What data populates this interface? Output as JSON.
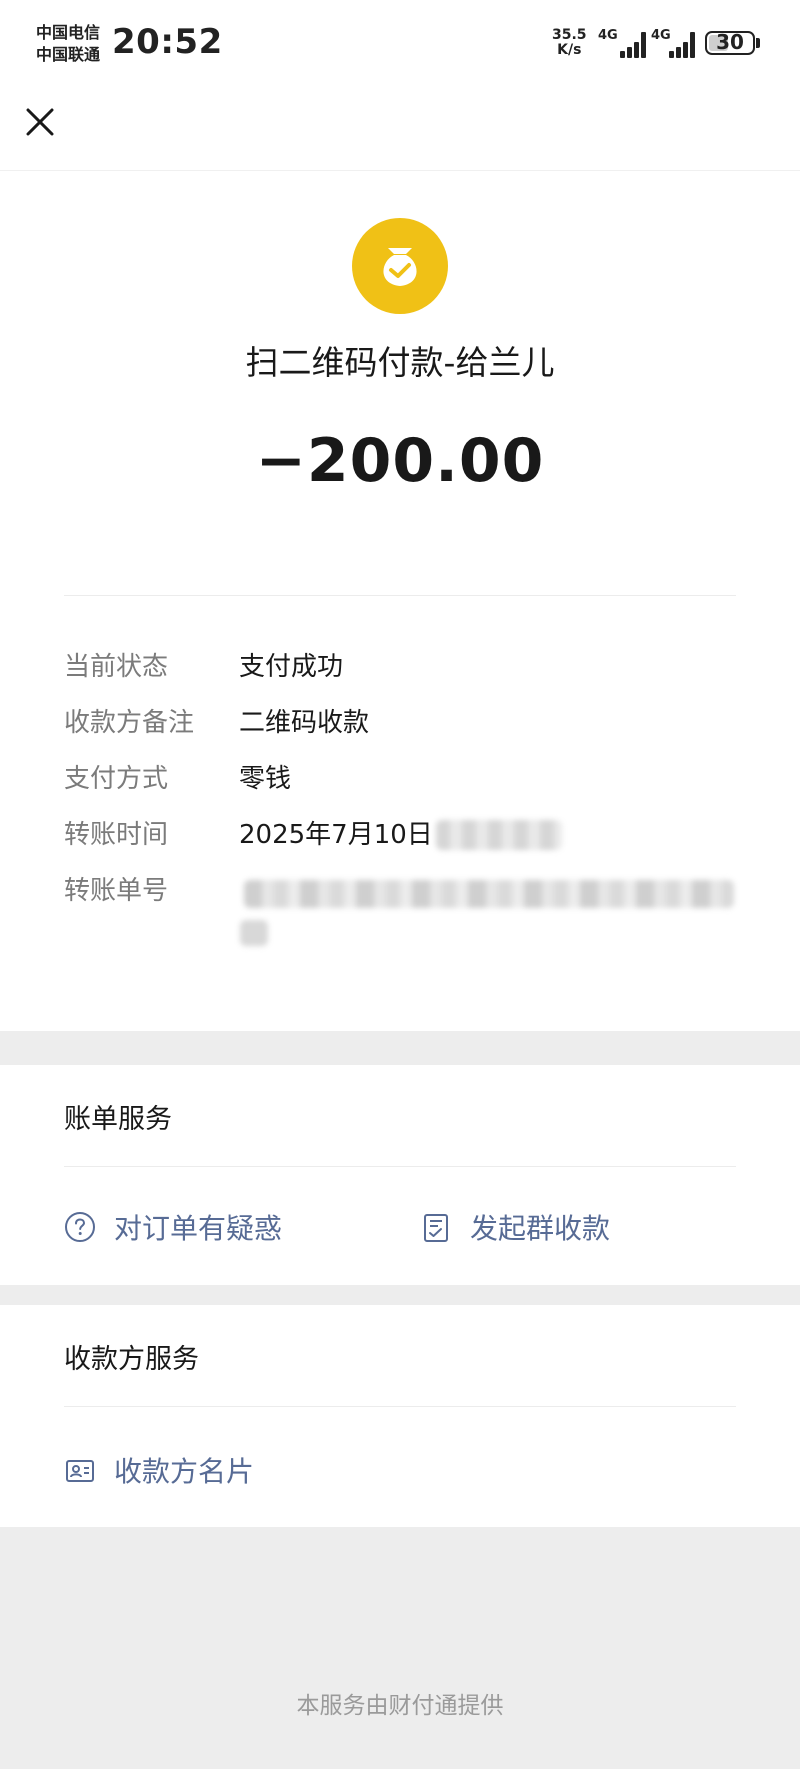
{
  "status_bar": {
    "carrier_1": "中国电信",
    "carrier_2": "中国联通",
    "time": "20:52",
    "net_speed_value": "35.5",
    "net_speed_unit": "K/s",
    "signal_1_label": "4G",
    "signal_2_label": "4G",
    "battery": "30"
  },
  "transaction": {
    "merchant": "扫二维码付款-给兰儿",
    "amount": "−200.00",
    "details": [
      {
        "label": "当前状态",
        "value": "支付成功"
      },
      {
        "label": "收款方备注",
        "value": "二维码收款"
      },
      {
        "label": "支付方式",
        "value": "零钱"
      },
      {
        "label": "转账时间",
        "value": "2025年7月10日"
      },
      {
        "label": "转账单号",
        "value": ""
      }
    ]
  },
  "bill_services": {
    "title": "账单服务",
    "items": [
      {
        "label": "对订单有疑惑",
        "icon": "question-circle-icon"
      },
      {
        "label": "发起群收款",
        "icon": "checklist-icon"
      }
    ]
  },
  "payee_services": {
    "title": "收款方服务",
    "items": [
      {
        "label": "收款方名片",
        "icon": "id-card-icon"
      }
    ]
  },
  "footer": "本服务由财付通提供",
  "colors": {
    "accent_link": "#576b95",
    "icon_yellow": "#f0c116",
    "background": "#ededed"
  }
}
